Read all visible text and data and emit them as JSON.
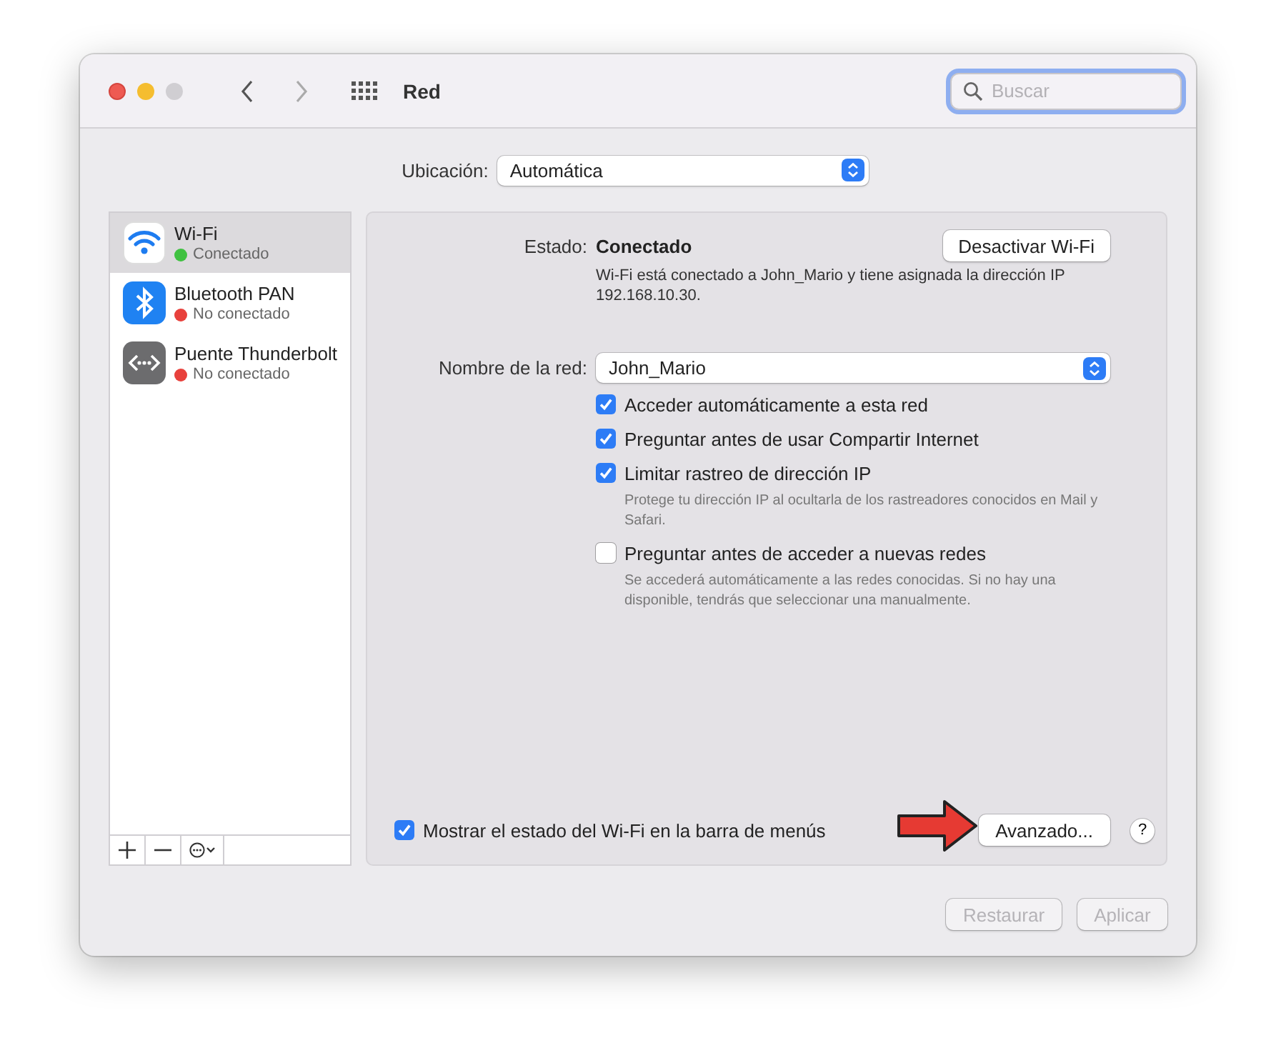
{
  "window": {
    "title": "Red",
    "search": {
      "placeholder": "Buscar"
    }
  },
  "location": {
    "label": "Ubicación:",
    "value": "Automática"
  },
  "services": [
    {
      "name": "Wi-Fi",
      "status": "Conectado",
      "color": "#3fc140",
      "kind": "wifi",
      "selected": true
    },
    {
      "name": "Bluetooth PAN",
      "status": "No conectado",
      "color": "#e8413c",
      "kind": "bluetooth",
      "selected": false
    },
    {
      "name": "Puente Thunderbolt",
      "status": "No conectado",
      "color": "#e8413c",
      "kind": "bridge",
      "selected": false
    }
  ],
  "status": {
    "label": "Estado:",
    "value": "Conectado",
    "button": "Desactivar Wi-Fi",
    "description": "Wi-Fi está conectado a John_Mario y tiene asignada la dirección IP 192.168.10.30."
  },
  "network": {
    "label": "Nombre de la red:",
    "value": "John_Mario"
  },
  "options": [
    {
      "label": "Acceder automáticamente a esta red",
      "checked": true
    },
    {
      "label": "Preguntar antes de usar Compartir Internet",
      "checked": true
    },
    {
      "label": "Limitar rastreo de dirección IP",
      "checked": true,
      "note": "Protege tu dirección IP al ocultarla de los rastreadores conocidos en Mail y Safari."
    },
    {
      "label": "Preguntar antes de acceder a nuevas redes",
      "checked": false,
      "note": "Se accederá automáticamente a las redes conocidas. Si no hay una disponible, tendrás que seleccionar una manualmente."
    }
  ],
  "menu_bar_option": {
    "label": "Mostrar el estado del Wi-Fi en la barra de menús",
    "checked": true
  },
  "advanced_button": "Avanzado...",
  "help_button": "?",
  "buttons": [
    {
      "label": "Restaurar",
      "disabled": true
    },
    {
      "label": "Aplicar",
      "disabled": true
    }
  ]
}
